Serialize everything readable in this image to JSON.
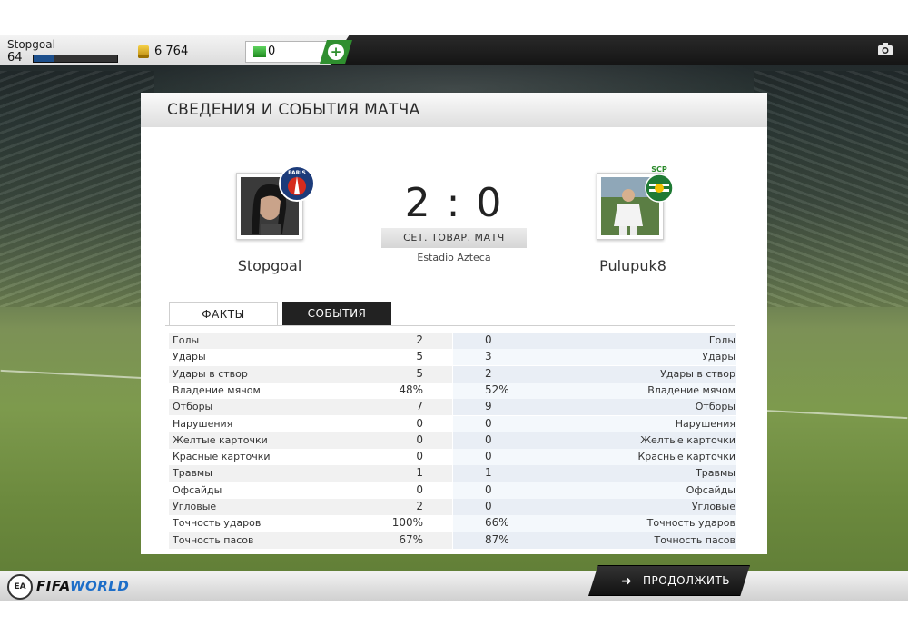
{
  "topbar": {
    "player_name": "Stopgoal",
    "player_level": "64",
    "xp_progress": 0.25,
    "coins": "6 764",
    "points": "0",
    "add_button": "+"
  },
  "panel": {
    "title": "СВЕДЕНИЯ И СОБЫТИЯ МАТЧА"
  },
  "match": {
    "home_team": "Stopgoal",
    "away_team": "Pulupuk8",
    "home_badge_text": "PARIS",
    "away_badge_text": "SCP",
    "score": "2 : 0",
    "match_type": "СЕТ. ТОВАР. МАТЧ",
    "stadium": "Estadio Azteca"
  },
  "tabs": {
    "facts": "ФАКТЫ",
    "events": "СОБЫТИЯ"
  },
  "stats": [
    {
      "label": "Голы",
      "home": "2",
      "away": "0"
    },
    {
      "label": "Удары",
      "home": "5",
      "away": "3"
    },
    {
      "label": "Удары в створ",
      "home": "5",
      "away": "2"
    },
    {
      "label": "Владение мячом",
      "home": "48%",
      "away": "52%"
    },
    {
      "label": "Отборы",
      "home": "7",
      "away": "9"
    },
    {
      "label": "Нарушения",
      "home": "0",
      "away": "0"
    },
    {
      "label": "Желтые карточки",
      "home": "0",
      "away": "0"
    },
    {
      "label": "Красные карточки",
      "home": "0",
      "away": "0"
    },
    {
      "label": "Травмы",
      "home": "1",
      "away": "1"
    },
    {
      "label": "Офсайды",
      "home": "0",
      "away": "0"
    },
    {
      "label": "Угловые",
      "home": "2",
      "away": "0"
    },
    {
      "label": "Точность ударов",
      "home": "100%",
      "away": "66%"
    },
    {
      "label": "Точность пасов",
      "home": "67%",
      "away": "87%"
    }
  ],
  "bottombar": {
    "ea_logo": "EA",
    "logo_fifa": "FIFA",
    "logo_world": "WORLD",
    "continue_label": "ПРОДОЛЖИТЬ",
    "continue_arrow": "➜"
  },
  "icons": {
    "coins": "coins-icon",
    "points": "points-icon",
    "camera": "camera-icon",
    "continue": "arrow-right-icon"
  }
}
